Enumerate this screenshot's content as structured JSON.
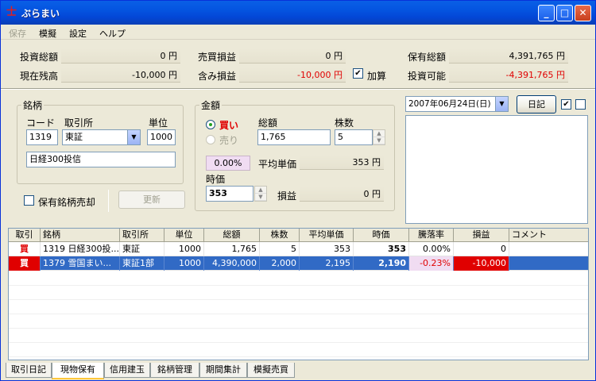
{
  "window": {
    "title": "ぶらまい"
  },
  "menu": [
    "保存",
    "模擬",
    "設定",
    "ヘルプ"
  ],
  "summary": {
    "investment_total_label": "投資総額",
    "investment_total": "0 円",
    "current_balance_label": "現在残高",
    "current_balance": "-10,000 円",
    "trade_pl_label": "売買損益",
    "trade_pl": "0 円",
    "unrealized_pl_label": "含み損益",
    "unrealized_pl": "-10,000 円",
    "add_label": "加算",
    "add_checked": true,
    "holdings_total_label": "保有総額",
    "holdings_total": "4,391,765 円",
    "investable_label": "投資可能",
    "investable": "-4,391,765 円"
  },
  "stock_group": {
    "title": "銘柄",
    "code_label": "コード",
    "code": "1319",
    "exchange_label": "取引所",
    "exchange": "東証",
    "unit_label": "単位",
    "unit": "1000",
    "name": "日経300投信",
    "sell_holdings_label": "保有銘柄売却",
    "update_label": "更新"
  },
  "amount_group": {
    "title": "金額",
    "buy_label": "買い",
    "sell_label": "売り",
    "total_label": "総額",
    "total": "1,765",
    "shares_label": "株数",
    "shares": "5",
    "rate": "0.00%",
    "avg_price_label": "平均単価",
    "avg_price": "353 円",
    "price_label": "時価",
    "price": "353",
    "pl_label": "損益",
    "pl": "0 円"
  },
  "diary": {
    "date": "2007年06月24日(日)",
    "button_label": "日記",
    "check1": true,
    "check2": false
  },
  "grid": {
    "columns": [
      "取引",
      "銘柄",
      "取引所",
      "単位",
      "総額",
      "株数",
      "平均単価",
      "時価",
      "騰落率",
      "損益",
      "コメント"
    ],
    "rows": [
      {
        "trade": "買",
        "name": "1319 日経300投...",
        "exchange": "東証",
        "unit": "1000",
        "total": "1,765",
        "shares": "5",
        "avg": "353",
        "price": "353",
        "rate": "0.00%",
        "pl": "0",
        "comment": ""
      },
      {
        "trade": "買",
        "name": "1379 雪国まい...",
        "exchange": "東証1部",
        "unit": "1000",
        "total": "4,390,000",
        "shares": "2,000",
        "avg": "2,195",
        "price": "2,190",
        "rate": "-0.23%",
        "pl": "-10,000",
        "comment": ""
      }
    ]
  },
  "tabs": [
    "取引日記",
    "現物保有",
    "信用建玉",
    "銘柄管理",
    "期間集計",
    "模擬売買"
  ],
  "active_tab": 1,
  "colors": {
    "accent_blue": "#316ac5",
    "trade_red": "#e00000",
    "title_blue": "#0454e0"
  }
}
